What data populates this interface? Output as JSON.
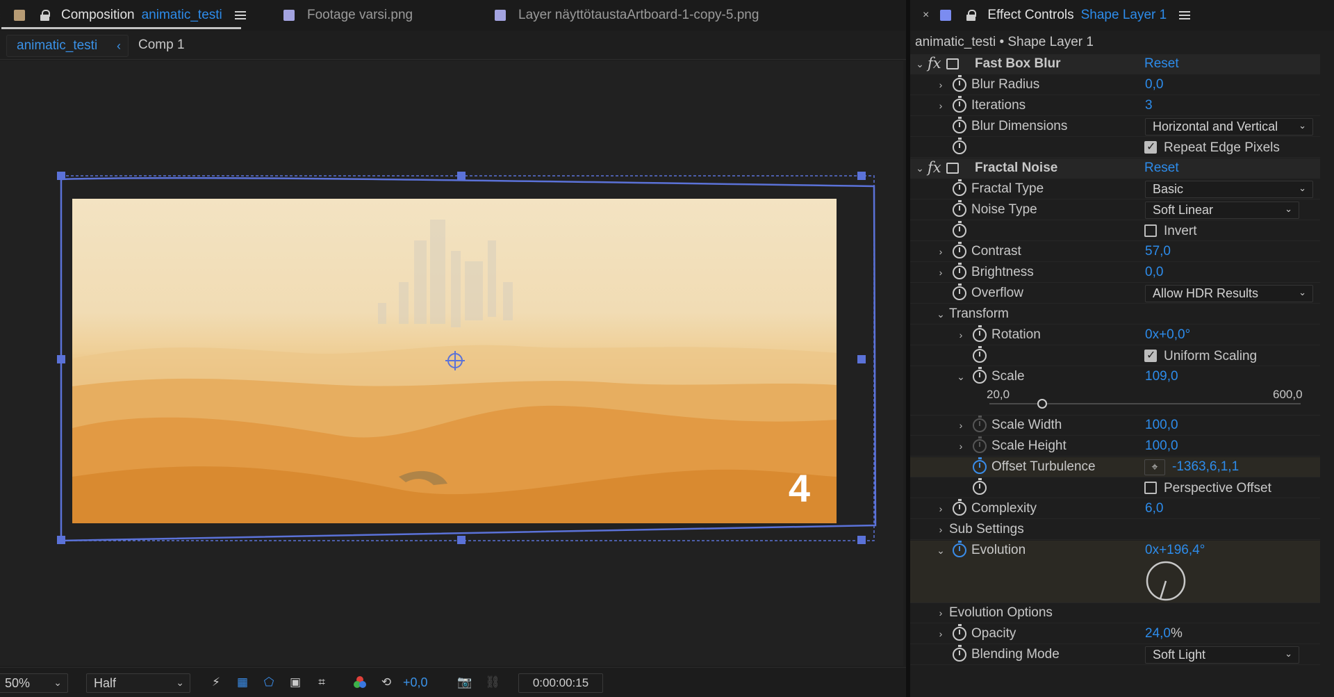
{
  "left_tabs": {
    "composition_prefix": "Composition",
    "composition_name": "animatic_testi",
    "footage": "Footage varsi.png",
    "layer": "Layer näyttötaustaArtboard-1-copy-5.png"
  },
  "breadcrumb": {
    "active": "animatic_testi",
    "other": "Comp 1"
  },
  "viewer": {
    "frame_number": "4"
  },
  "viewer_toolbar": {
    "zoom": "50%",
    "resolution": "Half",
    "exposure": "+0,0",
    "timecode": "0:00:00:15"
  },
  "effect_controls": {
    "tab_title": "Effect Controls",
    "tab_layer": "Shape Layer 1",
    "subtitle": "animatic_testi • Shape Layer 1",
    "fast_box_blur": {
      "name": "Fast Box Blur",
      "reset": "Reset",
      "blur_radius": {
        "label": "Blur Radius",
        "value": "0,0"
      },
      "iterations": {
        "label": "Iterations",
        "value": "3"
      },
      "blur_dimensions": {
        "label": "Blur Dimensions",
        "value": "Horizontal and Vertical"
      },
      "repeat_edge": {
        "label": "Repeat Edge Pixels",
        "checked": true
      }
    },
    "fractal_noise": {
      "name": "Fractal Noise",
      "reset": "Reset",
      "fractal_type": {
        "label": "Fractal Type",
        "value": "Basic"
      },
      "noise_type": {
        "label": "Noise Type",
        "value": "Soft Linear"
      },
      "invert": {
        "label": "Invert",
        "checked": false
      },
      "contrast": {
        "label": "Contrast",
        "value": "57,0"
      },
      "brightness": {
        "label": "Brightness",
        "value": "0,0"
      },
      "overflow": {
        "label": "Overflow",
        "value": "Allow HDR Results"
      },
      "transform": {
        "label": "Transform",
        "rotation": {
          "label": "Rotation",
          "value": "0x+0,0°"
        },
        "uniform_scaling": {
          "label": "Uniform Scaling",
          "checked": true
        },
        "scale": {
          "label": "Scale",
          "value": "109,0",
          "min": "20,0",
          "max": "600,0"
        },
        "scale_width": {
          "label": "Scale Width",
          "value": "100,0"
        },
        "scale_height": {
          "label": "Scale Height",
          "value": "100,0"
        },
        "offset_turbulence": {
          "label": "Offset Turbulence",
          "value": "-1363,6,1,1"
        },
        "perspective_offset": {
          "label": "Perspective Offset",
          "checked": false
        }
      },
      "complexity": {
        "label": "Complexity",
        "value": "6,0"
      },
      "sub_settings": {
        "label": "Sub Settings"
      },
      "evolution": {
        "label": "Evolution",
        "value": "0x+196,4°"
      },
      "evolution_options": {
        "label": "Evolution Options"
      },
      "opacity": {
        "label": "Opacity",
        "value": "24,0",
        "unit": "%"
      },
      "blending_mode": {
        "label": "Blending Mode",
        "value": "Soft Light"
      }
    }
  },
  "colors": {
    "accent": "#2d8ceb",
    "selection_box": "#5b72d8",
    "panel_bg": "#1e1e1e"
  }
}
